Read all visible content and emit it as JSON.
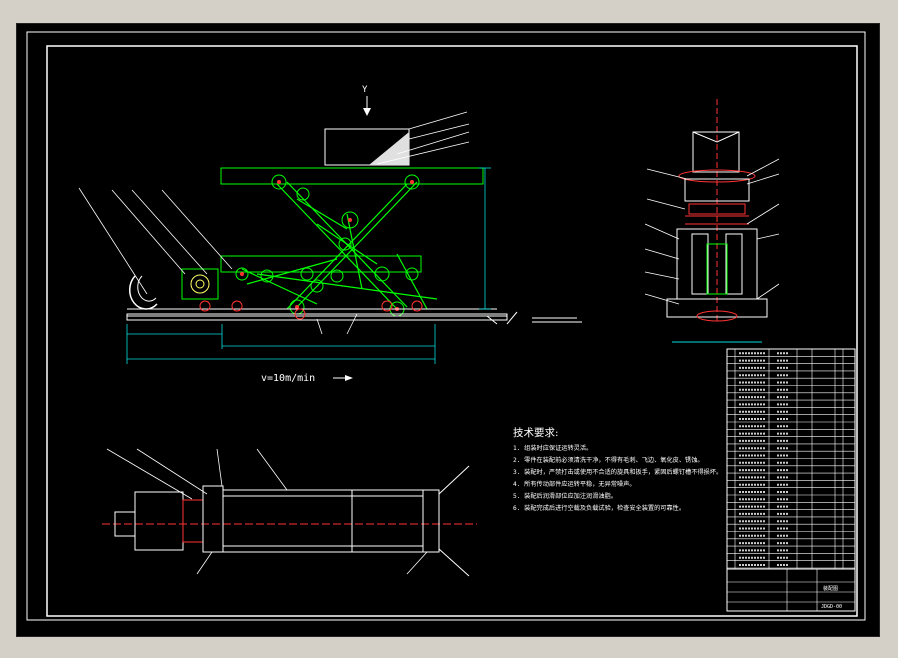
{
  "drawing": {
    "view_label_y": "Y",
    "speed_label": "v=10m/min",
    "tech_req_title": "技术要求:",
    "tech_req_lines": [
      "1. 组装时应保证运转灵活。",
      "2. 零件在装配前必须清洗干净，不得有毛刺、飞边、氧化皮、锈蚀。",
      "3. 装配时，严禁打击或使用不合适的旋具和扳手，紧固后螺钉槽不得损坏。",
      "4. 所有传动部件应运转平稳，无异常噪声。",
      "5. 装配后润滑部位应加注润滑油脂。",
      "6. 装配完成后进行空载及负载试验，检查安全装置的可靠性。"
    ]
  },
  "title_block": {
    "drawing_number": "JDGD-00",
    "drawing_name": "装配图"
  },
  "colors": {
    "background": "#000000",
    "outline": "#ffffff",
    "mechanism": "#00ff00",
    "highlight": "#ff3333",
    "dimension": "#00dddd",
    "hatch": "#ffff66"
  }
}
